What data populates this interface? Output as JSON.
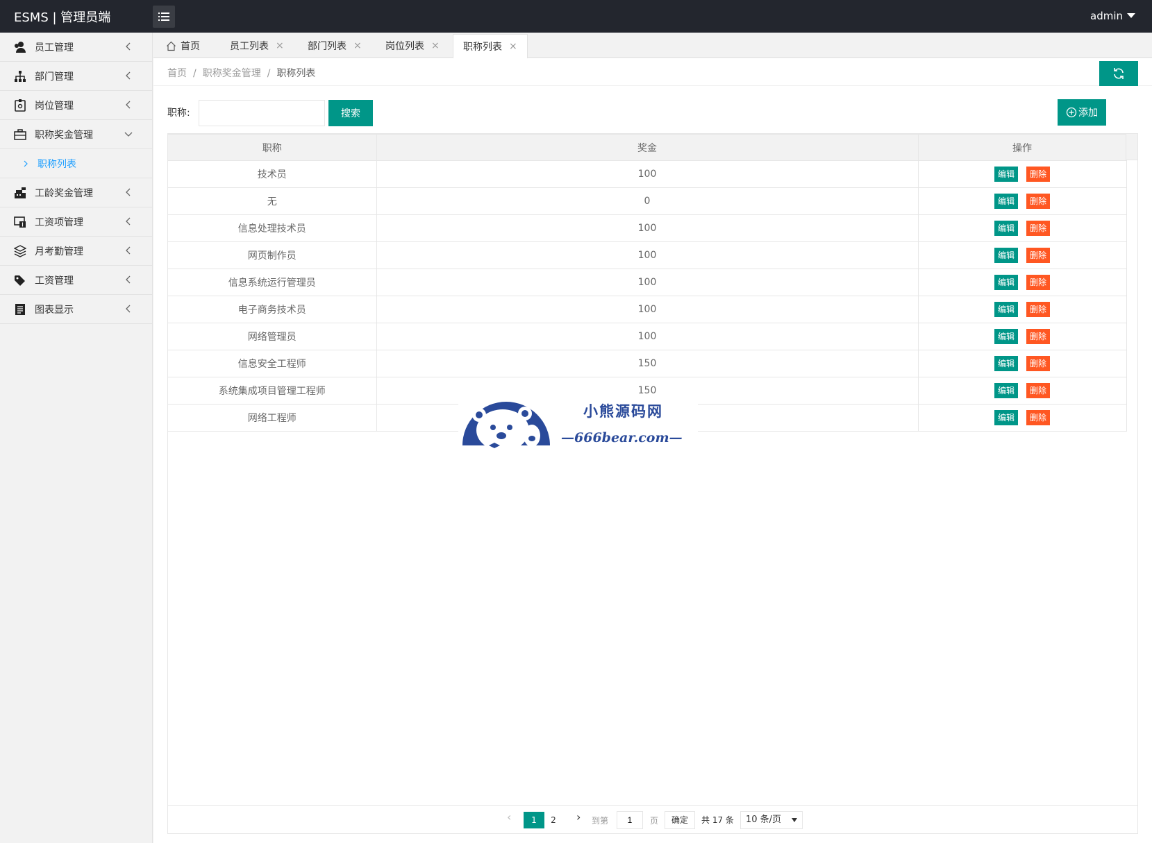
{
  "app": {
    "title": "ESMS | 管理员端",
    "user": "admin"
  },
  "sidebar": {
    "items": [
      {
        "label": "员工管理",
        "icon": "users-icon"
      },
      {
        "label": "部门管理",
        "icon": "sitemap-icon"
      },
      {
        "label": "岗位管理",
        "icon": "badge-icon"
      },
      {
        "label": "职称奖金管理",
        "icon": "briefcase-icon"
      },
      {
        "label": "工龄奖金管理",
        "icon": "cash-register-icon"
      },
      {
        "label": "工资项管理",
        "icon": "money-screen-icon"
      },
      {
        "label": "月考勤管理",
        "icon": "layers-icon"
      },
      {
        "label": "工资管理",
        "icon": "tags-icon"
      },
      {
        "label": "图表显示",
        "icon": "receipt-icon"
      }
    ],
    "sub_item": "职称列表"
  },
  "tabs": [
    {
      "label": "首页"
    },
    {
      "label": "员工列表"
    },
    {
      "label": "部门列表"
    },
    {
      "label": "岗位列表"
    },
    {
      "label": "职称列表"
    }
  ],
  "tab_close_symbol": "×",
  "breadcrumb": {
    "items": [
      "首页",
      "职称奖金管理",
      "职称列表"
    ],
    "sep": "/"
  },
  "search": {
    "label": "职称:",
    "value": "",
    "button": "搜索"
  },
  "add_button": "添加",
  "table": {
    "columns": [
      "职称",
      "奖金",
      "操作"
    ],
    "rows": [
      {
        "title": "技术员",
        "bonus": "100"
      },
      {
        "title": "无",
        "bonus": "0"
      },
      {
        "title": "信息处理技术员",
        "bonus": "100"
      },
      {
        "title": "网页制作员",
        "bonus": "100"
      },
      {
        "title": "信息系统运行管理员",
        "bonus": "100"
      },
      {
        "title": "电子商务技术员",
        "bonus": "100"
      },
      {
        "title": "网络管理员",
        "bonus": "100"
      },
      {
        "title": "信息安全工程师",
        "bonus": "150"
      },
      {
        "title": "系统集成项目管理工程师",
        "bonus": "150"
      },
      {
        "title": "网络工程师",
        "bonus": ""
      }
    ],
    "edit_label": "编辑",
    "delete_label": "删除"
  },
  "pager": {
    "current": "1",
    "next_page": "2",
    "goto_label": "到第",
    "goto_value": "1",
    "page_unit": "页",
    "confirm": "确定",
    "total": "共 17 条",
    "page_size": "10 条/页"
  },
  "watermark": {
    "line1": "小熊源码网",
    "line2": "—666bear.com—"
  },
  "colors": {
    "primary": "#009688",
    "danger": "#ff5722",
    "header": "#23262e",
    "link": "#1e9fff"
  }
}
